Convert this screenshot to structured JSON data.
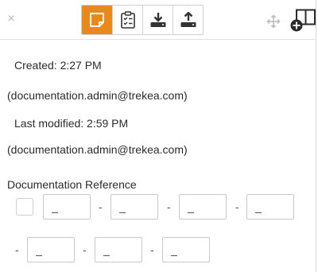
{
  "toolbar": {
    "close_symbol": "×",
    "tools": [
      {
        "icon": "sticky-note-icon",
        "active": true
      },
      {
        "icon": "clipboard-checklist-icon",
        "active": false
      },
      {
        "icon": "download-tray-icon",
        "active": false
      },
      {
        "icon": "upload-tray-icon",
        "active": false
      }
    ],
    "accent_color": "#e8891a"
  },
  "meta": {
    "created_label": "Created: 2:27 PM",
    "created_by": "(documentation.admin@trekea.com)",
    "modified_label": "Last modified: 2:59 PM",
    "modified_by": "(documentation.admin@trekea.com)"
  },
  "reference": {
    "title": "Documentation Reference",
    "fields": [
      "_",
      "_",
      "_",
      "_",
      "_",
      "_",
      "_"
    ],
    "separator": "-"
  }
}
